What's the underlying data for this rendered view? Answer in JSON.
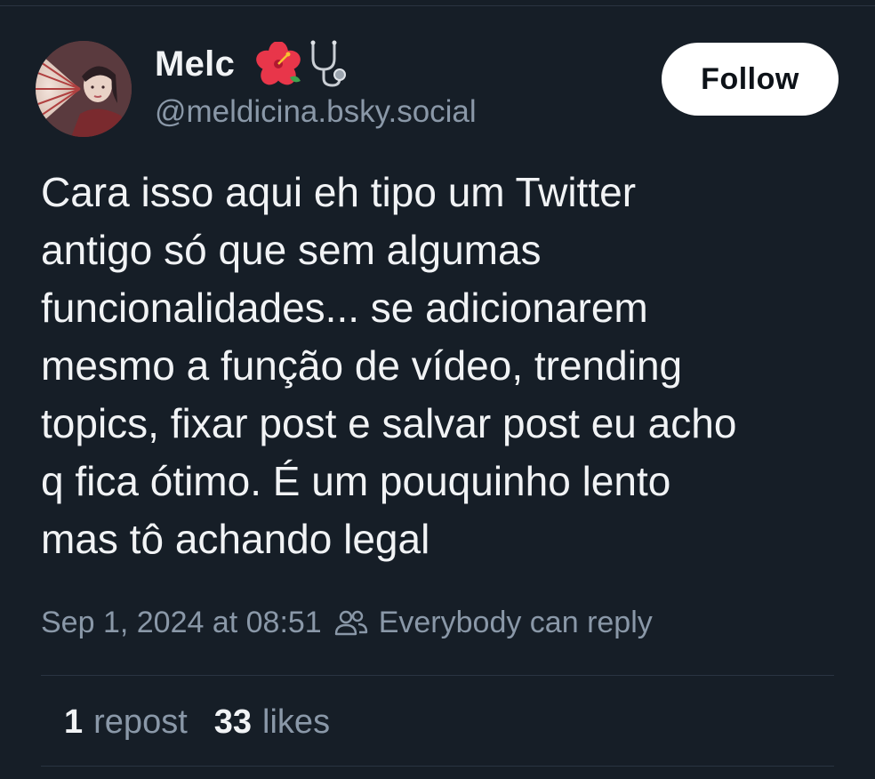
{
  "author": {
    "display_name": "Melc",
    "handle": "@meldicina.bsky.social",
    "name_emojis": [
      "hibiscus-emoji",
      "stethoscope-emoji"
    ]
  },
  "follow_button": {
    "label": "Follow"
  },
  "post": {
    "text": "Cara isso aqui eh tipo um Twitter\nantigo só que sem algumas\nfuncionalidades... se adicionarem\nmesmo a função de vídeo, trending\ntopics, fixar post e salvar post eu acho\nq fica ótimo. É um pouquinho lento\nmas tô achando legal",
    "timestamp": "Sep 1, 2024 at 08:51",
    "reply_setting": "Everybody can reply"
  },
  "stats": {
    "reposts_count": "1",
    "reposts_label": "repost",
    "likes_count": "33",
    "likes_label": "likes"
  },
  "colors": {
    "background": "#161e27",
    "text_primary": "#f1f3f5",
    "text_secondary": "#8a98a8",
    "divider": "#2a3441",
    "follow_bg": "#ffffff"
  }
}
